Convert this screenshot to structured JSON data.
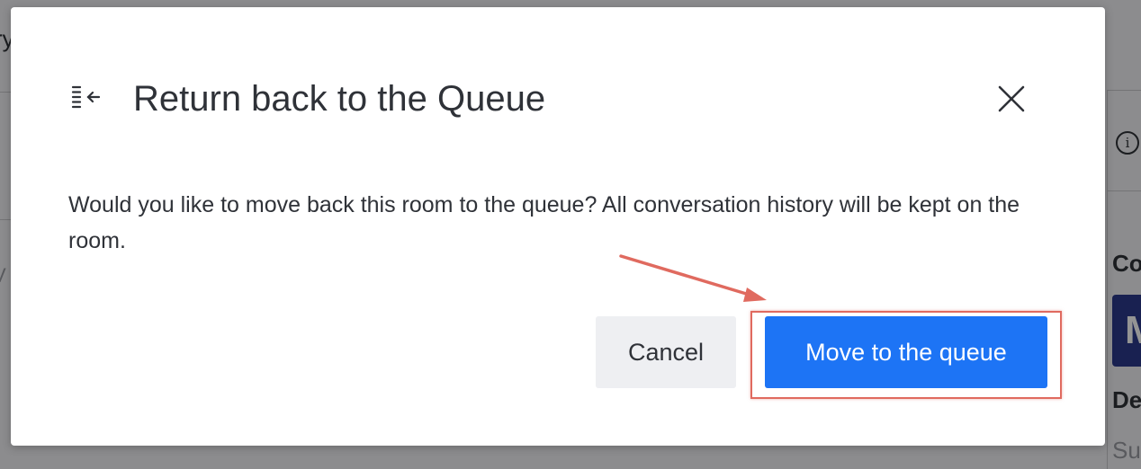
{
  "background": {
    "partial_texts": [
      "ry",
      "Co",
      "M",
      "De",
      "Su",
      "V"
    ]
  },
  "modal": {
    "title": "Return back to the Queue",
    "title_icon": "return-to-queue-icon",
    "close_icon": "close-icon",
    "body": "Would you like to move back this room to the queue? All conversation history will be kept on the room.",
    "cancel_label": "Cancel",
    "confirm_label": "Move to the queue"
  },
  "colors": {
    "primary": "#1d74f5",
    "secondary_bg": "#eeeff2",
    "text": "#2f3238",
    "annotation": "#e06a5f"
  }
}
